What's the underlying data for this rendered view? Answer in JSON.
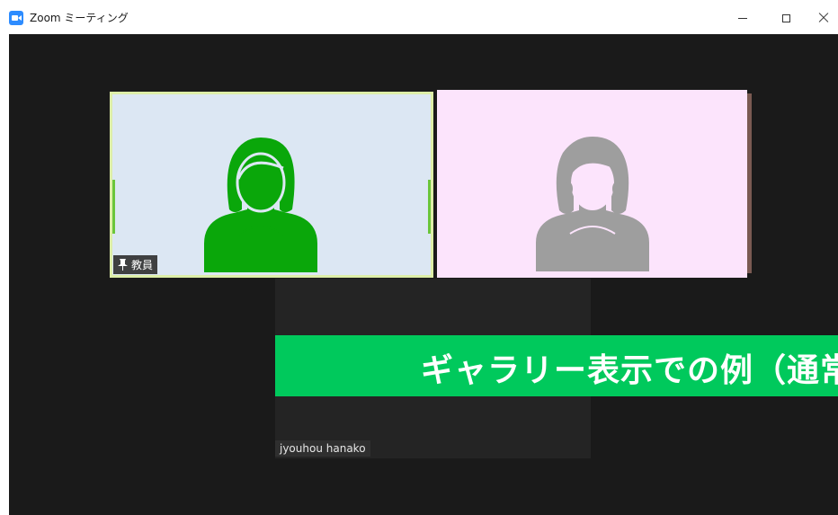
{
  "window": {
    "title": "Zoom ミーティング",
    "controls": [
      "minimize",
      "maximize",
      "close"
    ]
  },
  "participants": [
    {
      "name": "教員",
      "pinned": true,
      "avatar_color": "#0aa70a",
      "tile_bg": "#dce7f3",
      "active_speaker": true
    },
    {
      "name": "",
      "pinned": false,
      "avatar_color": "#9e9e9e",
      "tile_bg": "#fce4fc",
      "active_speaker": false
    },
    {
      "name": "jyouhou hanako",
      "pinned": false,
      "video_off": true
    }
  ],
  "banner": {
    "text": "ギャラリー表示での例（通常",
    "bg_color": "#00c95c"
  },
  "colors": {
    "meeting_bg": "#1a1a1a",
    "active_border": "#ddeea8",
    "accent": "#2d8cff"
  }
}
